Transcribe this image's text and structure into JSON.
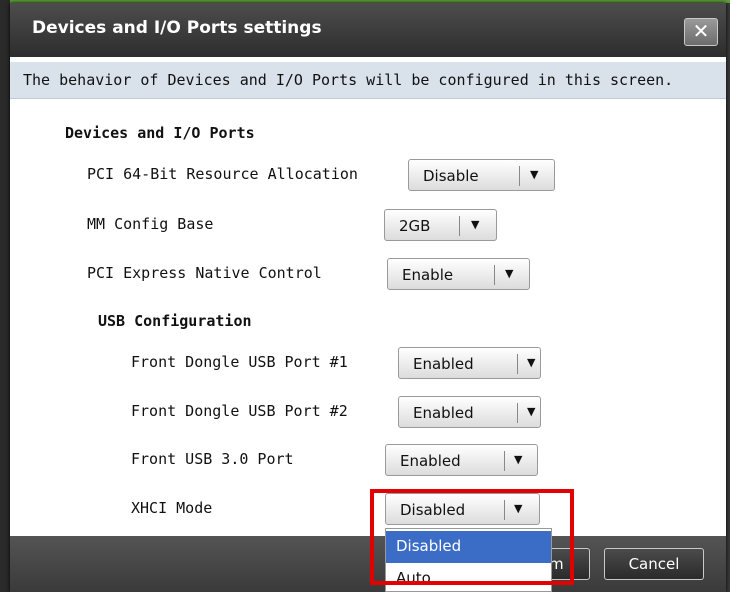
{
  "dialog": {
    "title": "Devices and I/O Ports settings",
    "close_glyph": "✕",
    "info_text": "The behavior of Devices and I/O Ports will be configured in this screen."
  },
  "section": {
    "heading": "Devices and I/O Ports",
    "fields": [
      {
        "label": "PCI 64-Bit Resource Allocation",
        "value": "Disable"
      },
      {
        "label": "MM Config Base",
        "value": "2GB"
      },
      {
        "label": "PCI Express Native Control",
        "value": "Enable"
      }
    ]
  },
  "usb": {
    "heading": "USB Configuration",
    "fields": [
      {
        "label": "Front Dongle USB Port #1",
        "value": "Enabled"
      },
      {
        "label": "Front Dongle USB Port #2",
        "value": "Enabled"
      },
      {
        "label": "Front USB 3.0 Port",
        "value": "Enabled"
      },
      {
        "label": "XHCI Mode",
        "value": "Disabled"
      }
    ]
  },
  "dropdown": {
    "options": [
      "Disabled",
      "Auto"
    ],
    "selected": "Disabled"
  },
  "footer": {
    "confirm_label": "Confirm",
    "cancel_label": "Cancel"
  },
  "icons": {
    "arrow_glyph": "▼"
  },
  "colors": {
    "titlebar": "#3a3a3a",
    "infobar": "#d9e2ea",
    "selected_option": "#3b6dc7",
    "highlight": "#e30000"
  }
}
